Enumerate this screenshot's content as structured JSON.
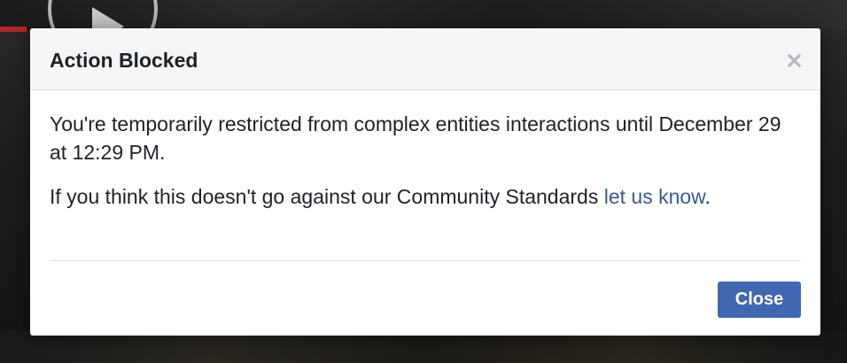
{
  "dialog": {
    "title": "Action Blocked",
    "message": "You're temporarily restricted from complex entities interactions until December 29 at 12:29 PM.",
    "appeal_text": "If you think this doesn't go against our Community Standards ",
    "appeal_link": "let us know",
    "appeal_suffix": ".",
    "close_button_label": "Close",
    "close_icon": "close-icon"
  },
  "background": {
    "video_icon": "play-icon"
  },
  "colors": {
    "brand_button": "#4267b2",
    "link": "#385898",
    "header_bg": "#f5f6f7",
    "text": "#1d2129"
  }
}
